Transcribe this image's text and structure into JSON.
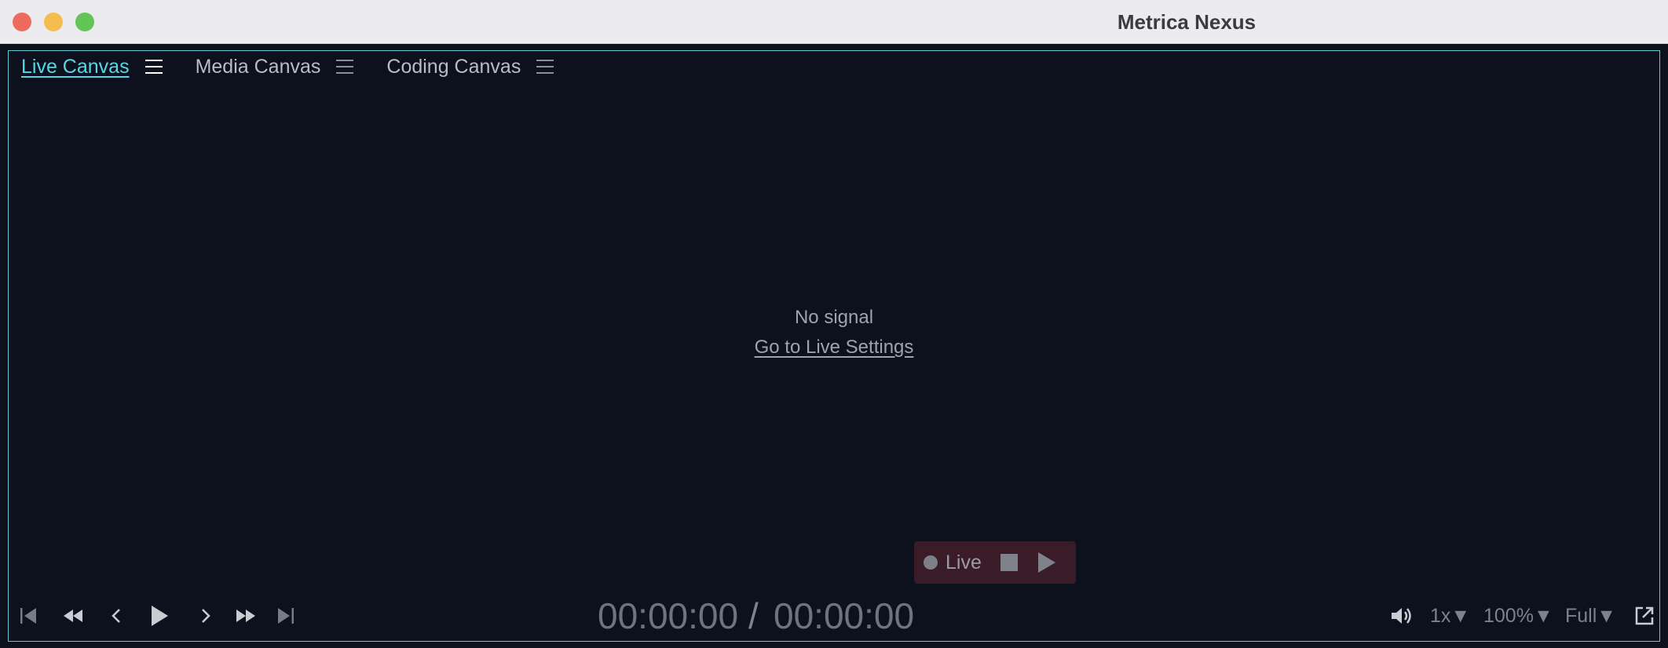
{
  "window": {
    "title": "Metrica Nexus"
  },
  "tabs": [
    {
      "label": "Live Canvas",
      "active": true
    },
    {
      "label": "Media Canvas",
      "active": false
    },
    {
      "label": "Coding Canvas",
      "active": false
    }
  ],
  "canvas": {
    "status": "No signal",
    "settings_link": "Go to Live Settings"
  },
  "transport": {
    "icons": [
      "skip-to-start-icon",
      "rewind-icon",
      "step-back-icon",
      "play-icon",
      "step-forward-icon",
      "fast-forward-icon",
      "skip-to-end-icon"
    ],
    "current_time": "00:00:00",
    "separator": "/",
    "total_time": "00:00:00"
  },
  "live": {
    "label": "Live",
    "icons": [
      "record-dot-icon",
      "stop-icon",
      "play-icon"
    ]
  },
  "view_controls": {
    "speed": "1x▼",
    "zoom": "100%▼",
    "quality": "Full▼",
    "icons": [
      "volume-icon",
      "popout-icon"
    ]
  },
  "colors": {
    "accent": "#56d7e6",
    "background": "#0c111d",
    "live_box": "#3a1c28"
  }
}
